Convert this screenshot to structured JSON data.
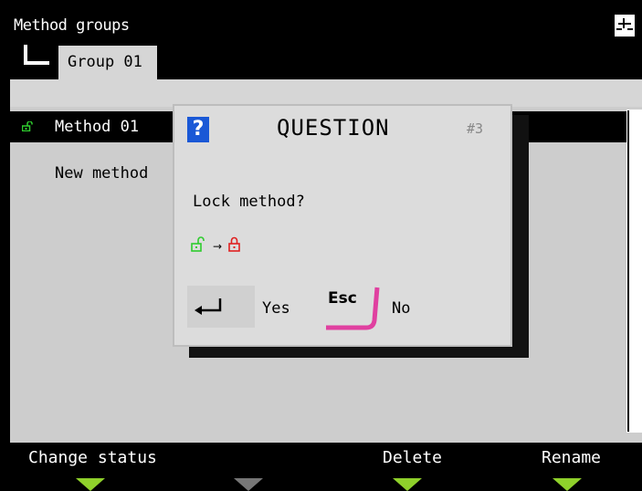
{
  "header": {
    "title": "Method groups",
    "tab": "Group 01",
    "save_icon": "save-to-storage-icon",
    "tree_icon": "tree-branch-icon"
  },
  "list": {
    "items": [
      {
        "label": "Method 01",
        "status_icon": "lock-open-icon",
        "status_color": "#2ecc2e",
        "selected": true
      },
      {
        "label": "New method",
        "selected": false
      }
    ]
  },
  "dialog": {
    "icon": "question-icon",
    "icon_glyph": "?",
    "title": "QUESTION",
    "number": "#3",
    "message": "Lock method?",
    "transition": {
      "from_icon": "lock-open-icon",
      "from_color": "#2ecc2e",
      "arrow": "→",
      "to_icon": "lock-closed-icon",
      "to_color": "#e02020"
    },
    "confirm": {
      "key_icon": "enter-key-icon",
      "label": "Yes"
    },
    "cancel": {
      "key_label": "Esc",
      "label": "No",
      "accent": "#e040a0"
    }
  },
  "softkeys": [
    {
      "label": "Change status",
      "arrow_color": "#8fd12b"
    },
    {
      "label": "",
      "arrow_color": "#777777"
    },
    {
      "label": "Delete",
      "arrow_color": "#8fd12b"
    },
    {
      "label": "Rename",
      "arrow_color": "#8fd12b"
    }
  ]
}
